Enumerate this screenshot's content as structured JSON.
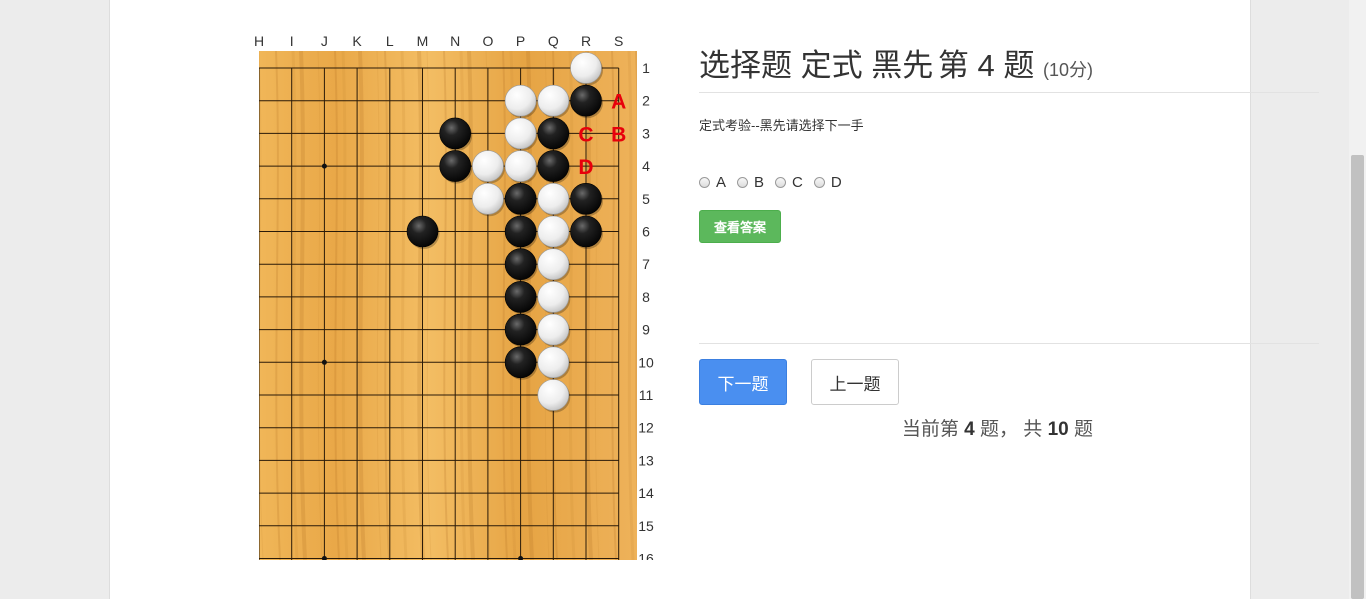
{
  "board": {
    "col_labels": [
      "H",
      "I",
      "J",
      "K",
      "L",
      "M",
      "N",
      "O",
      "P",
      "Q",
      "R",
      "S"
    ],
    "row_labels": [
      "1",
      "2",
      "3",
      "4",
      "5",
      "6",
      "7",
      "8",
      "9",
      "10",
      "11",
      "12",
      "13",
      "14",
      "15",
      "16"
    ],
    "stones": [
      {
        "col": "R",
        "row": 1,
        "color": "white"
      },
      {
        "col": "P",
        "row": 2,
        "color": "white"
      },
      {
        "col": "Q",
        "row": 2,
        "color": "white"
      },
      {
        "col": "R",
        "row": 2,
        "color": "black"
      },
      {
        "col": "N",
        "row": 3,
        "color": "black"
      },
      {
        "col": "P",
        "row": 3,
        "color": "white"
      },
      {
        "col": "Q",
        "row": 3,
        "color": "black"
      },
      {
        "col": "N",
        "row": 4,
        "color": "black"
      },
      {
        "col": "O",
        "row": 4,
        "color": "white"
      },
      {
        "col": "P",
        "row": 4,
        "color": "white"
      },
      {
        "col": "Q",
        "row": 4,
        "color": "black"
      },
      {
        "col": "O",
        "row": 5,
        "color": "white"
      },
      {
        "col": "P",
        "row": 5,
        "color": "black"
      },
      {
        "col": "Q",
        "row": 5,
        "color": "white"
      },
      {
        "col": "R",
        "row": 5,
        "color": "black"
      },
      {
        "col": "M",
        "row": 6,
        "color": "black"
      },
      {
        "col": "P",
        "row": 6,
        "color": "black"
      },
      {
        "col": "Q",
        "row": 6,
        "color": "white"
      },
      {
        "col": "R",
        "row": 6,
        "color": "black"
      },
      {
        "col": "P",
        "row": 7,
        "color": "black"
      },
      {
        "col": "Q",
        "row": 7,
        "color": "white"
      },
      {
        "col": "P",
        "row": 8,
        "color": "black"
      },
      {
        "col": "Q",
        "row": 8,
        "color": "white"
      },
      {
        "col": "P",
        "row": 9,
        "color": "black"
      },
      {
        "col": "Q",
        "row": 9,
        "color": "white"
      },
      {
        "col": "P",
        "row": 10,
        "color": "black"
      },
      {
        "col": "Q",
        "row": 10,
        "color": "white"
      },
      {
        "col": "Q",
        "row": 11,
        "color": "white"
      }
    ],
    "marks": [
      {
        "col": "S",
        "row": 2,
        "label": "A"
      },
      {
        "col": "S",
        "row": 3,
        "label": "B"
      },
      {
        "col": "R",
        "row": 3,
        "label": "C"
      },
      {
        "col": "R",
        "row": 4,
        "label": "D"
      }
    ],
    "star_points": [
      {
        "col": "J",
        "row": 4
      },
      {
        "col": "J",
        "row": 10
      },
      {
        "col": "P",
        "row": 16
      },
      {
        "col": "J",
        "row": 16
      }
    ],
    "mark_color": "#e8000b"
  },
  "question": {
    "title": "选择题 定式 黑先",
    "number_prefix": "第",
    "number": "4",
    "number_suffix": "题",
    "score": "(10分)",
    "description": "定式考验--黑先请选择下一手",
    "options": [
      "A",
      "B",
      "C",
      "D"
    ],
    "answer_button": "查看答案",
    "answer_button_color": "#5cb85c"
  },
  "nav": {
    "next_label": "下一题",
    "prev_label": "上一题",
    "next_color": "#4a8ff0",
    "progress_prefix": "当前第",
    "current": "4",
    "progress_mid": "题， 共",
    "total": "10",
    "progress_suffix": "题"
  }
}
